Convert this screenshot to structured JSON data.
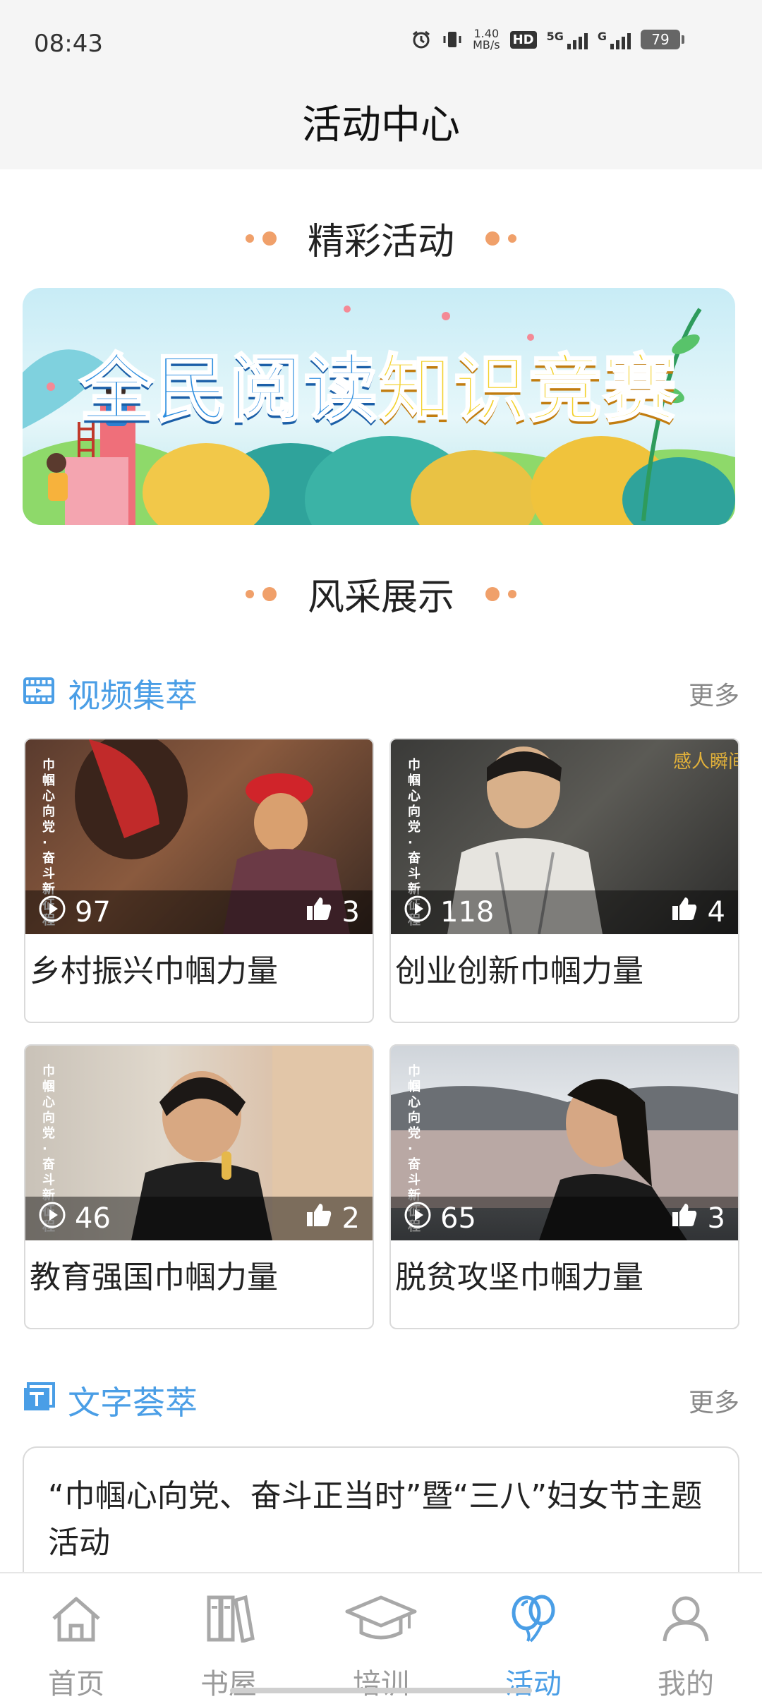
{
  "status": {
    "time": "08:43",
    "net_speed_value": "1.40",
    "net_speed_unit": "MB/s",
    "hd": "HD",
    "net1": "5G",
    "net2": "G",
    "battery": "79"
  },
  "header": {
    "title": "活动中心"
  },
  "sections": {
    "activities_title": "精彩活动",
    "showcase_title": "风采展示"
  },
  "banner": {
    "text_part1": "全民阅读",
    "text_part2": "知识竞赛"
  },
  "videos": {
    "title": "视频集萃",
    "more": "更多",
    "items": [
      {
        "caption": "乡村振兴巾帼力量",
        "plays": "97",
        "likes": "3",
        "side_text": "巾帼心向党·奋斗新征程"
      },
      {
        "caption": "创业创新巾帼力量",
        "plays": "118",
        "likes": "4",
        "side_text": "巾帼心向党·奋斗新征程"
      },
      {
        "caption": "教育强国巾帼力量",
        "plays": "46",
        "likes": "2",
        "side_text": "巾帼心向党·奋斗新征程"
      },
      {
        "caption": "脱贫攻坚巾帼力量",
        "plays": "65",
        "likes": "3",
        "side_text": "巾帼心向党·奋斗新征程"
      }
    ]
  },
  "texts": {
    "title": "文字荟萃",
    "more": "更多",
    "first_item": "“巾帼心向党、奋斗正当时”暨“三八”妇女节主题活动"
  },
  "nav": {
    "items": [
      {
        "label": "首页",
        "icon": "home-icon"
      },
      {
        "label": "书屋",
        "icon": "books-icon"
      },
      {
        "label": "培训",
        "icon": "graduation-cap-icon"
      },
      {
        "label": "活动",
        "icon": "balloons-icon"
      },
      {
        "label": "我的",
        "icon": "person-icon"
      }
    ],
    "active_index": 3
  },
  "colors": {
    "accent": "#4a9ee6",
    "dot": "#f0a06a"
  }
}
